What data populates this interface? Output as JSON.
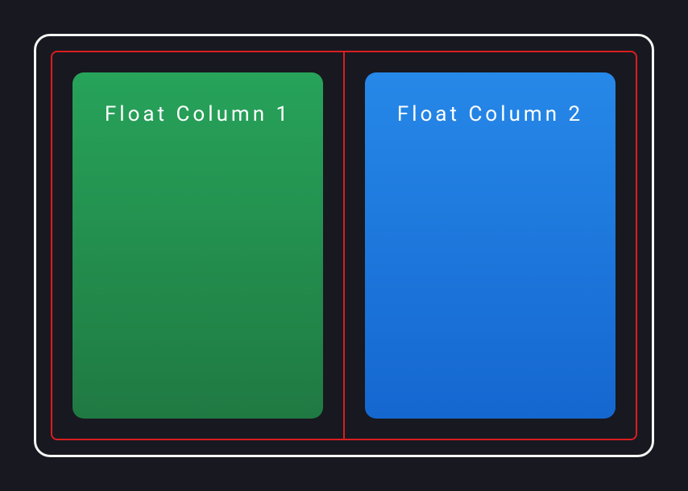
{
  "columns": [
    {
      "label": "Float Column 1"
    },
    {
      "label": "Float Column 2"
    }
  ]
}
